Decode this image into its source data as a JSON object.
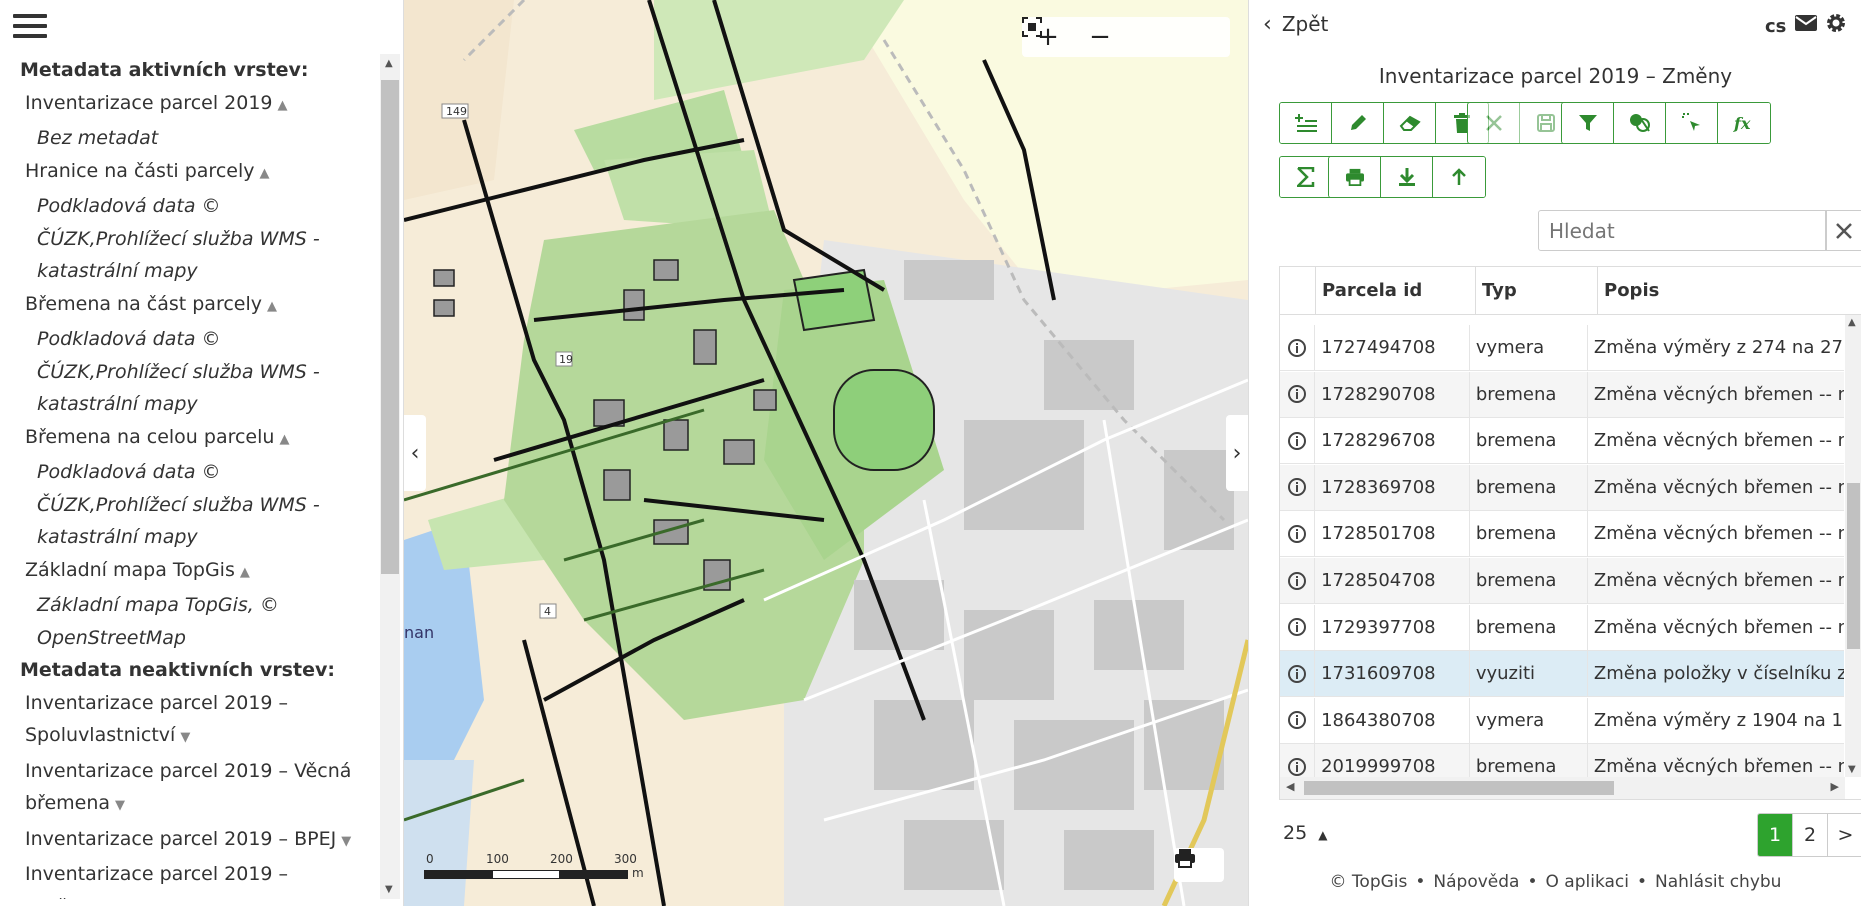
{
  "left": {
    "active_heading": "Metadata aktivních vrstev:",
    "active_layers": [
      {
        "name": "Inventarizace parcel 2019",
        "arrow": "▲",
        "desc": [
          "Bez metadat"
        ]
      },
      {
        "name": "Hranice na části parcely",
        "arrow": "▲",
        "desc": [
          "Podkladová data ©",
          "ČÚZK,Prohlížecí služba WMS -",
          "katastrální mapy"
        ]
      },
      {
        "name": "Břemena na část parcely",
        "arrow": "▲",
        "desc": [
          "Podkladová data ©",
          "ČÚZK,Prohlížecí služba WMS -",
          "katastrální mapy"
        ]
      },
      {
        "name": "Břemena na celou parcelu",
        "arrow": "▲",
        "desc": [
          "Podkladová data ©",
          "ČÚZK,Prohlížecí služba WMS -",
          "katastrální mapy"
        ]
      },
      {
        "name": "Základní mapa TopGis",
        "arrow": "▲",
        "desc": [
          "Základní mapa TopGis, ©",
          "OpenStreetMap"
        ]
      }
    ],
    "inactive_heading": "Metadata neaktivních vrstev:",
    "inactive_layers": [
      {
        "lines": [
          "Inventarizace parcel 2019 –",
          "Spoluvlastnictví"
        ],
        "arrow": "▼"
      },
      {
        "lines": [
          "Inventarizace parcel 2019 – Věcná",
          "břemena"
        ],
        "arrow": "▼"
      },
      {
        "lines": [
          "Inventarizace parcel 2019 – BPEJ"
        ],
        "arrow": "▼"
      },
      {
        "lines": [
          "Inventarizace parcel 2019 –",
          "Změny"
        ],
        "arrow": "▼"
      }
    ]
  },
  "map": {
    "controls": [
      "+",
      "−",
      "⛶",
      "⊡"
    ],
    "toggle_left": "‹",
    "toggle_right": "›",
    "scale_labels": [
      "0",
      "100",
      "200",
      "300"
    ],
    "scale_unit": "m",
    "map_labels": [
      "149",
      "19",
      "4",
      "nan"
    ]
  },
  "right": {
    "back": "Zpět",
    "lang": "cs",
    "title": "Inventarizace parcel 2019 – Změny",
    "toolbar_icons": {
      "row1_g1": [
        "add-row-icon",
        "edit-icon",
        "eraser-icon",
        "delete-icon"
      ],
      "row1_g2": [
        "cancel-icon",
        "save-icon"
      ],
      "row1_g3": [
        "filter-icon",
        "layers-icon",
        "select-icon",
        "fx-icon"
      ],
      "row2_g1": [
        "sum-icon"
      ],
      "row2_g2": [
        "print-icon",
        "download-icon",
        "upload-icon"
      ]
    },
    "search_placeholder": "Hledat",
    "columns": [
      "",
      "Parcela id",
      "Typ",
      "Popis"
    ],
    "rows": [
      {
        "id": "1727494708",
        "typ": "vymera",
        "popis": "Změna výměry z 274 na 27..."
      },
      {
        "id": "1728290708",
        "typ": "bremena",
        "popis": "Změna věcných břemen -- n"
      },
      {
        "id": "1728296708",
        "typ": "bremena",
        "popis": "Změna věcných břemen -- n"
      },
      {
        "id": "1728369708",
        "typ": "bremena",
        "popis": "Změna věcných břemen -- n"
      },
      {
        "id": "1728501708",
        "typ": "bremena",
        "popis": "Změna věcných břemen -- n"
      },
      {
        "id": "1728504708",
        "typ": "bremena",
        "popis": "Změna věcných břemen -- n"
      },
      {
        "id": "1729397708",
        "typ": "bremena",
        "popis": "Změna věcných břemen -- n"
      },
      {
        "id": "1731609708",
        "typ": "vyuziti",
        "popis": "Změna položky v číselníku z"
      },
      {
        "id": "1864380708",
        "typ": "vymera",
        "popis": "Změna výměry z 1904 na 1..."
      },
      {
        "id": "2019999708",
        "typ": "bremena",
        "popis": "Změna věcných břemen -- n"
      }
    ],
    "selected_row": 7,
    "page_size": "25",
    "page_size_arrow": "▲",
    "pages": [
      "1",
      "2",
      ">"
    ],
    "active_page": "1",
    "footer": [
      "© TopGis",
      "Nápověda",
      "O aplikaci",
      "Nahlásit chybu"
    ],
    "footer_sep": "•",
    "colors": {
      "accent": "#2ea32e",
      "selected_row": "#dcecf5",
      "map_green": "#b5d89a"
    }
  }
}
